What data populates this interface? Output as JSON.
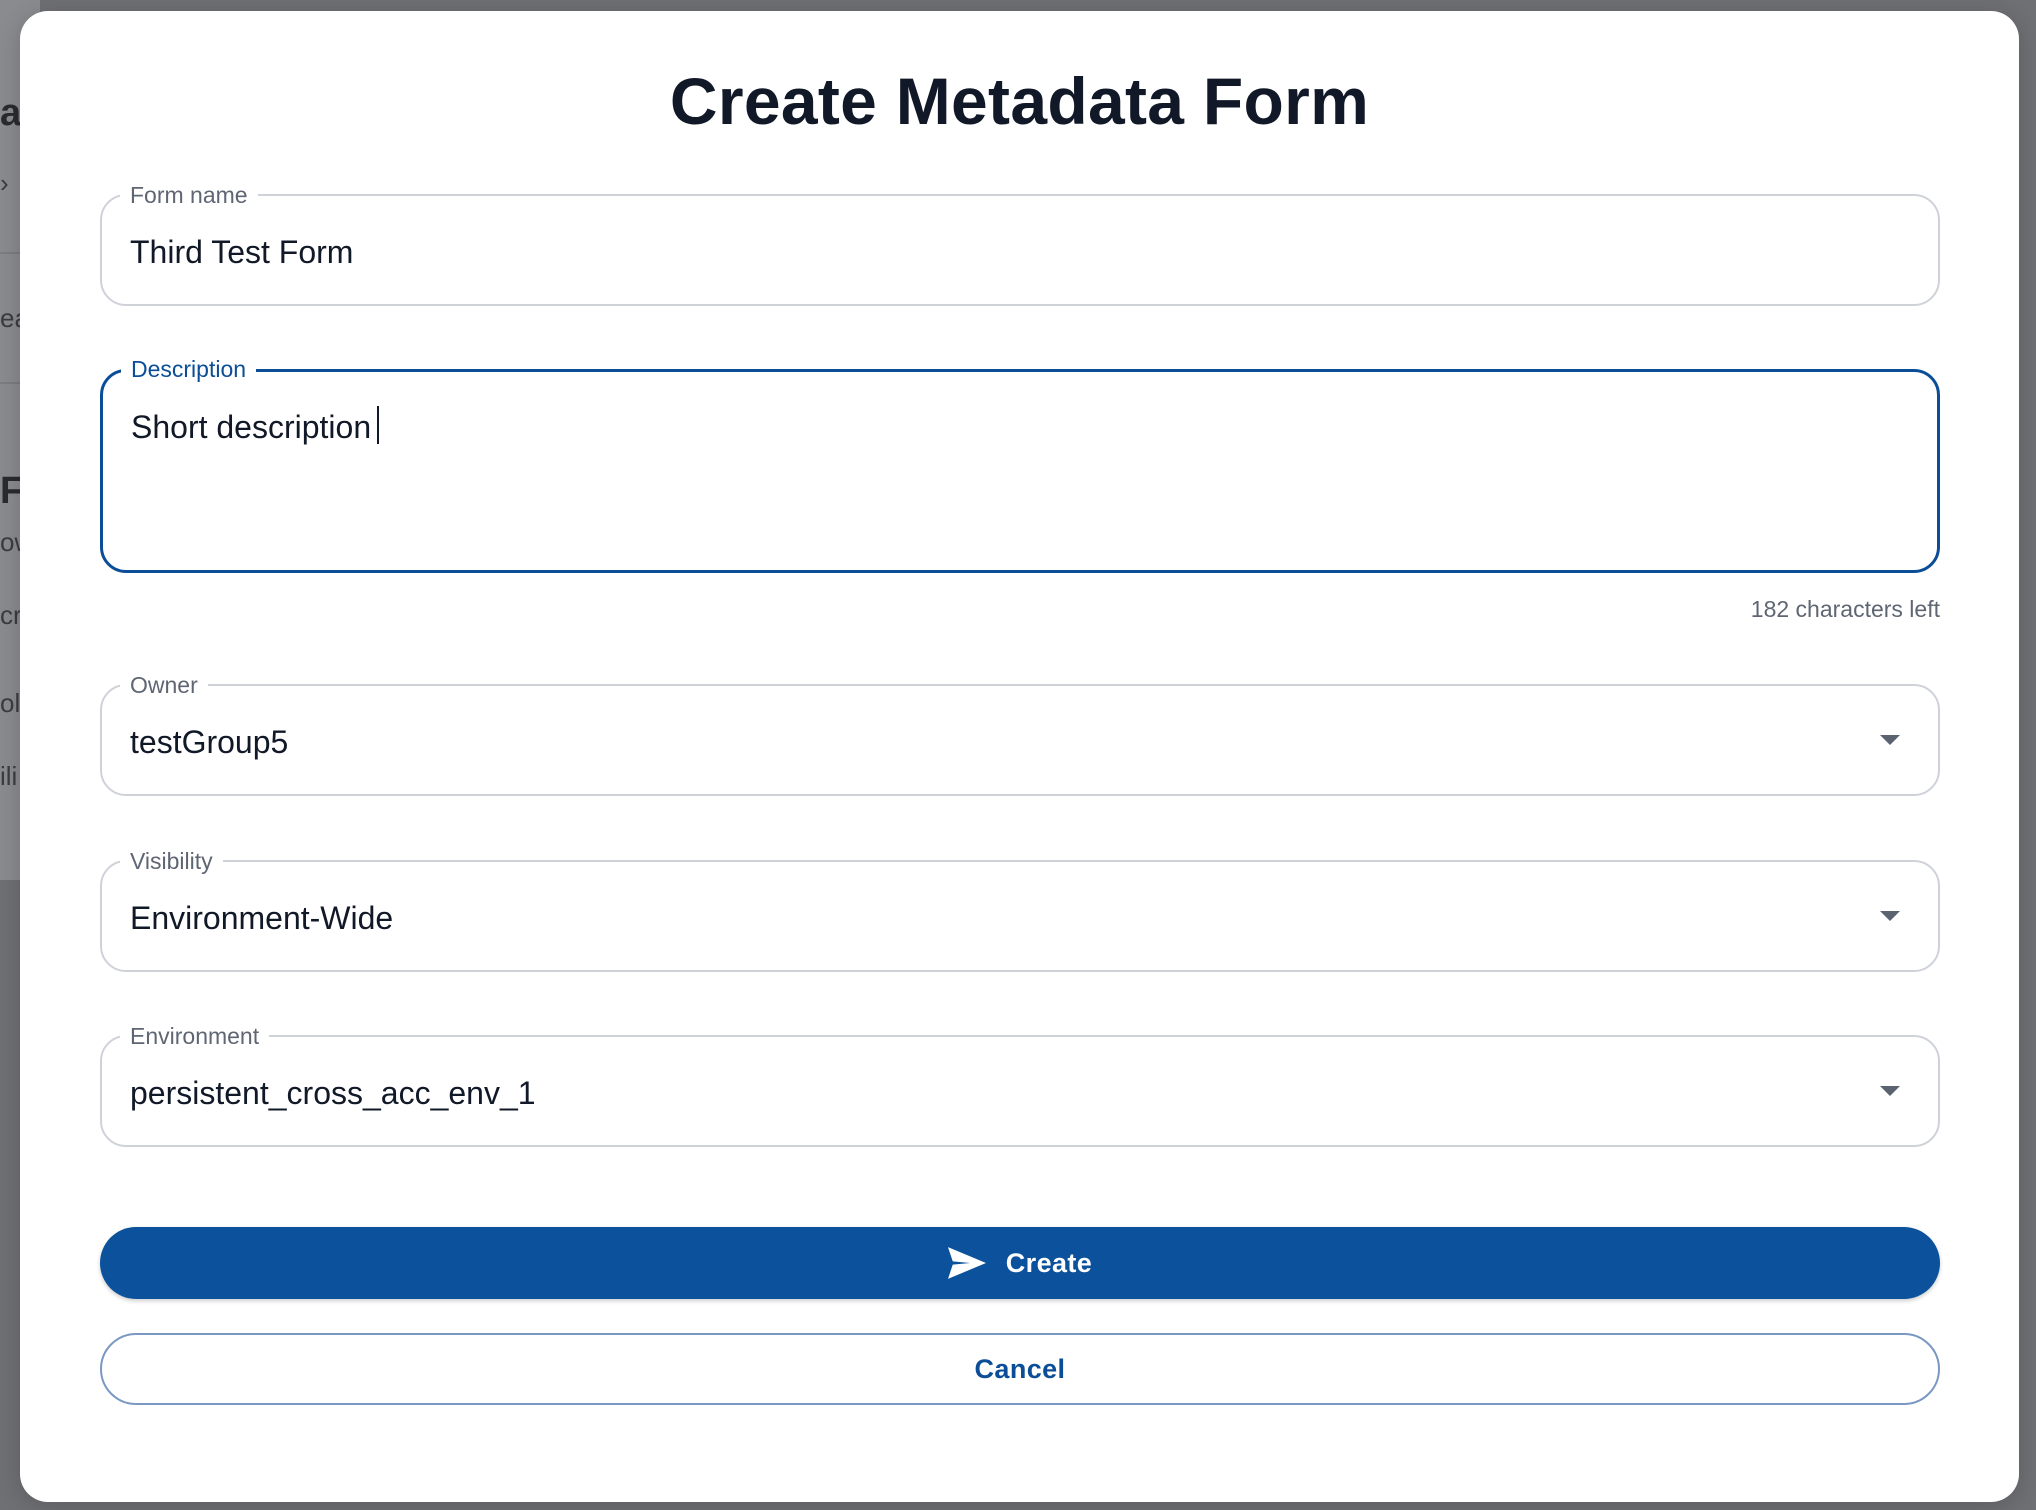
{
  "background": {
    "fragments": [
      "a",
      "",
      "ea",
      "Fi",
      "ow",
      "cri",
      "ol",
      "ili"
    ]
  },
  "modal": {
    "title": "Create Metadata Form",
    "fields": {
      "form_name": {
        "label": "Form name",
        "value": "Third Test Form"
      },
      "description": {
        "label": "Description",
        "value": "Short description",
        "helper": "182 characters left"
      },
      "owner": {
        "label": "Owner",
        "value": "testGroup5"
      },
      "visibility": {
        "label": "Visibility",
        "value": "Environment-Wide"
      },
      "environment": {
        "label": "Environment",
        "value": "persistent_cross_acc_env_1"
      }
    },
    "buttons": {
      "create": "Create",
      "cancel": "Cancel"
    }
  },
  "icons": {
    "create": "send-icon",
    "dropdown": "chevron-down-icon"
  },
  "colors": {
    "primary": "#0b519b",
    "focus_border": "#0b4e97",
    "title": "#111827"
  }
}
